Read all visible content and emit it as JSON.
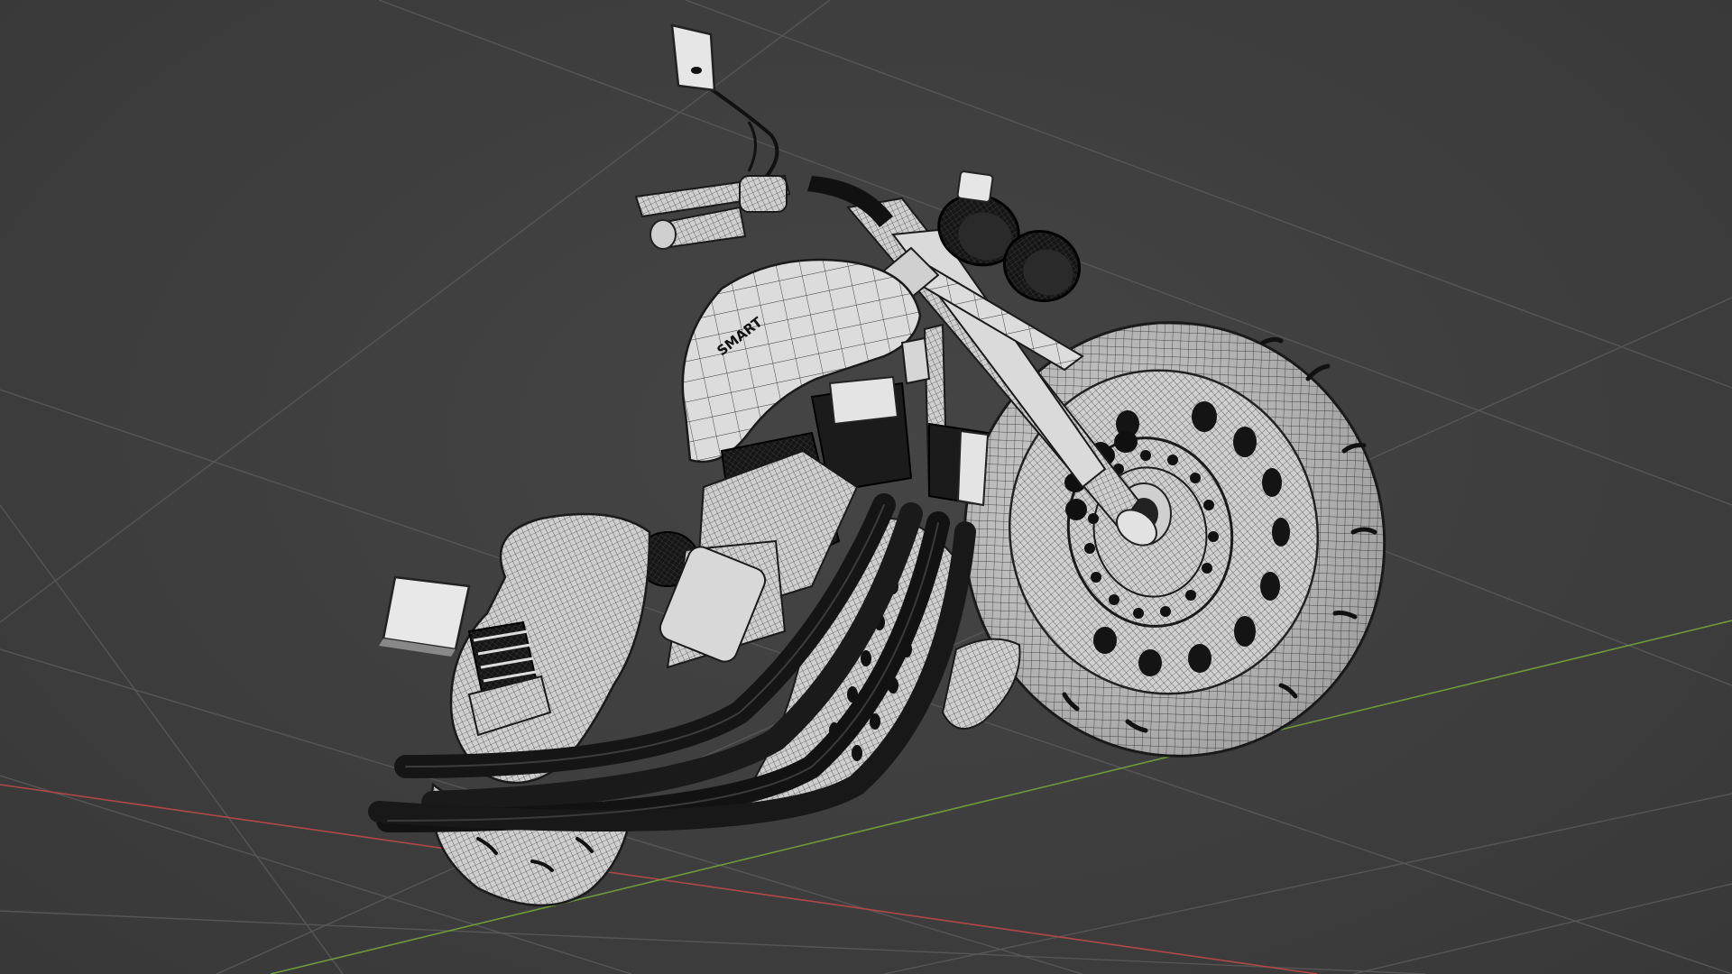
{
  "viewport": {
    "background_color": "#3d3d3d",
    "grid_color": "#565656",
    "x_axis_color": "#b04848",
    "y_axis_color": "#6f9a3a",
    "mesh_surface_color": "#d8d8d8",
    "wire_color": "#1a1a1a"
  },
  "model": {
    "emblem_text": "SMART"
  }
}
